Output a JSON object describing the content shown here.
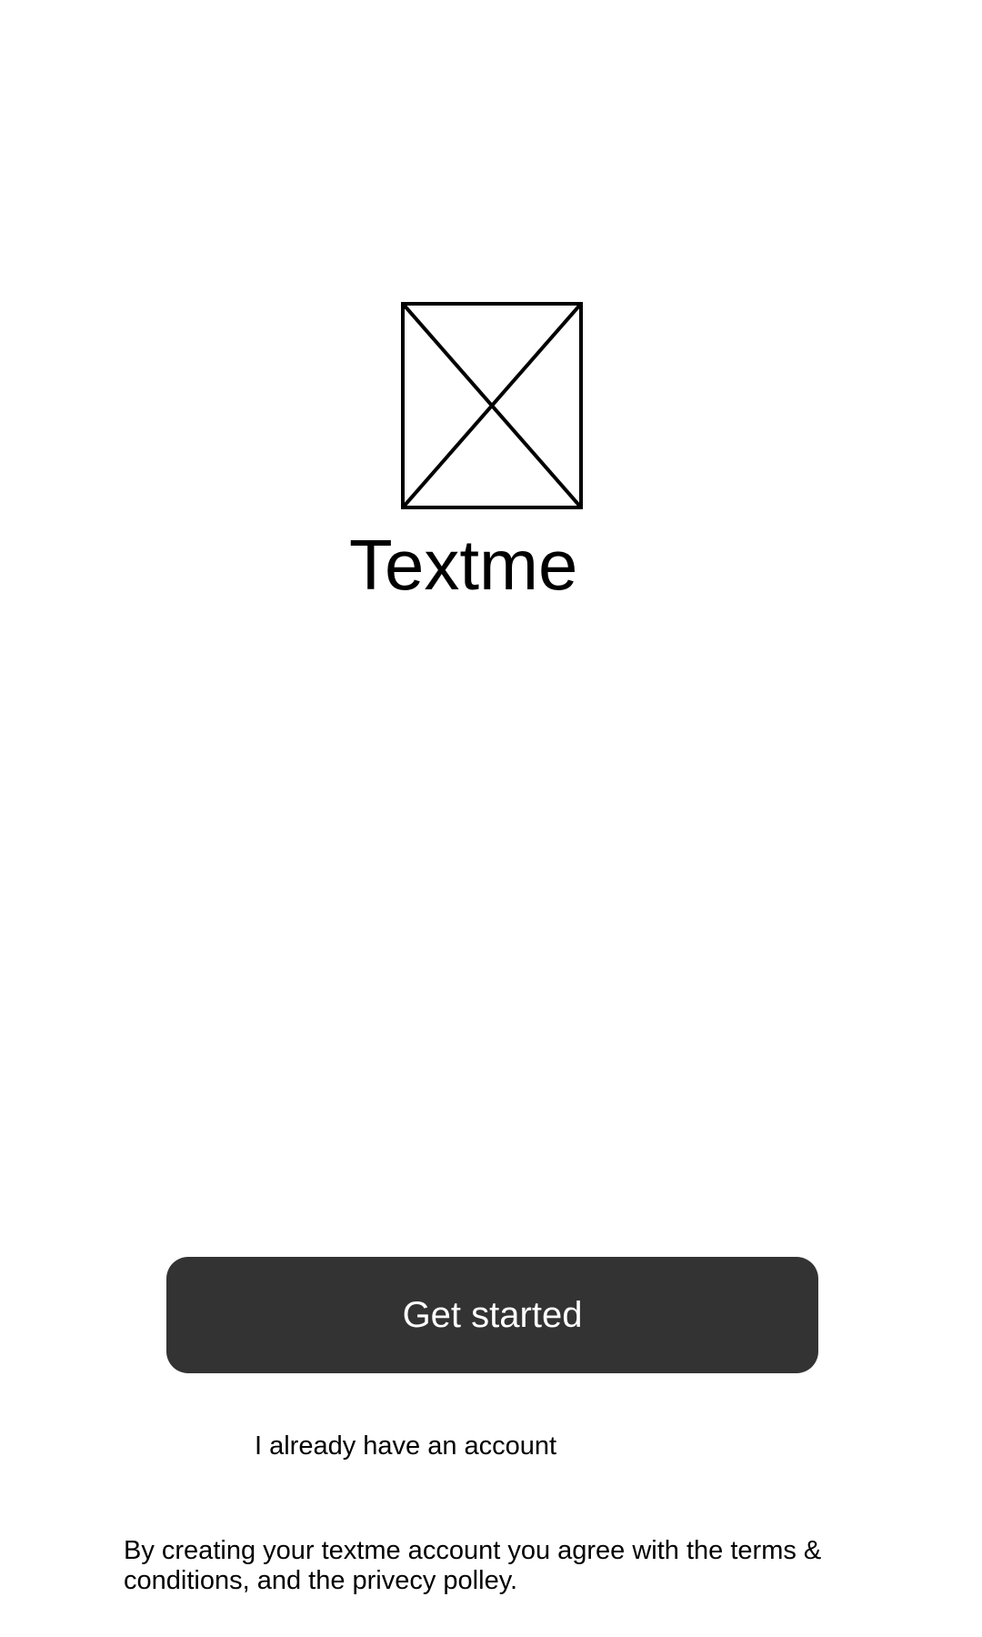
{
  "logo": {
    "icon": "image-placeholder-icon",
    "app_name": "Textme"
  },
  "actions": {
    "get_started_label": "Get started",
    "login_link_label": "I already have an account"
  },
  "footer": {
    "legal_text": "By creating your textme account you agree with the terms & conditions, and the privecy polley."
  },
  "colors": {
    "background": "#ffffff",
    "primary_button": "#333333",
    "primary_button_text": "#ffffff",
    "text": "#000000"
  }
}
